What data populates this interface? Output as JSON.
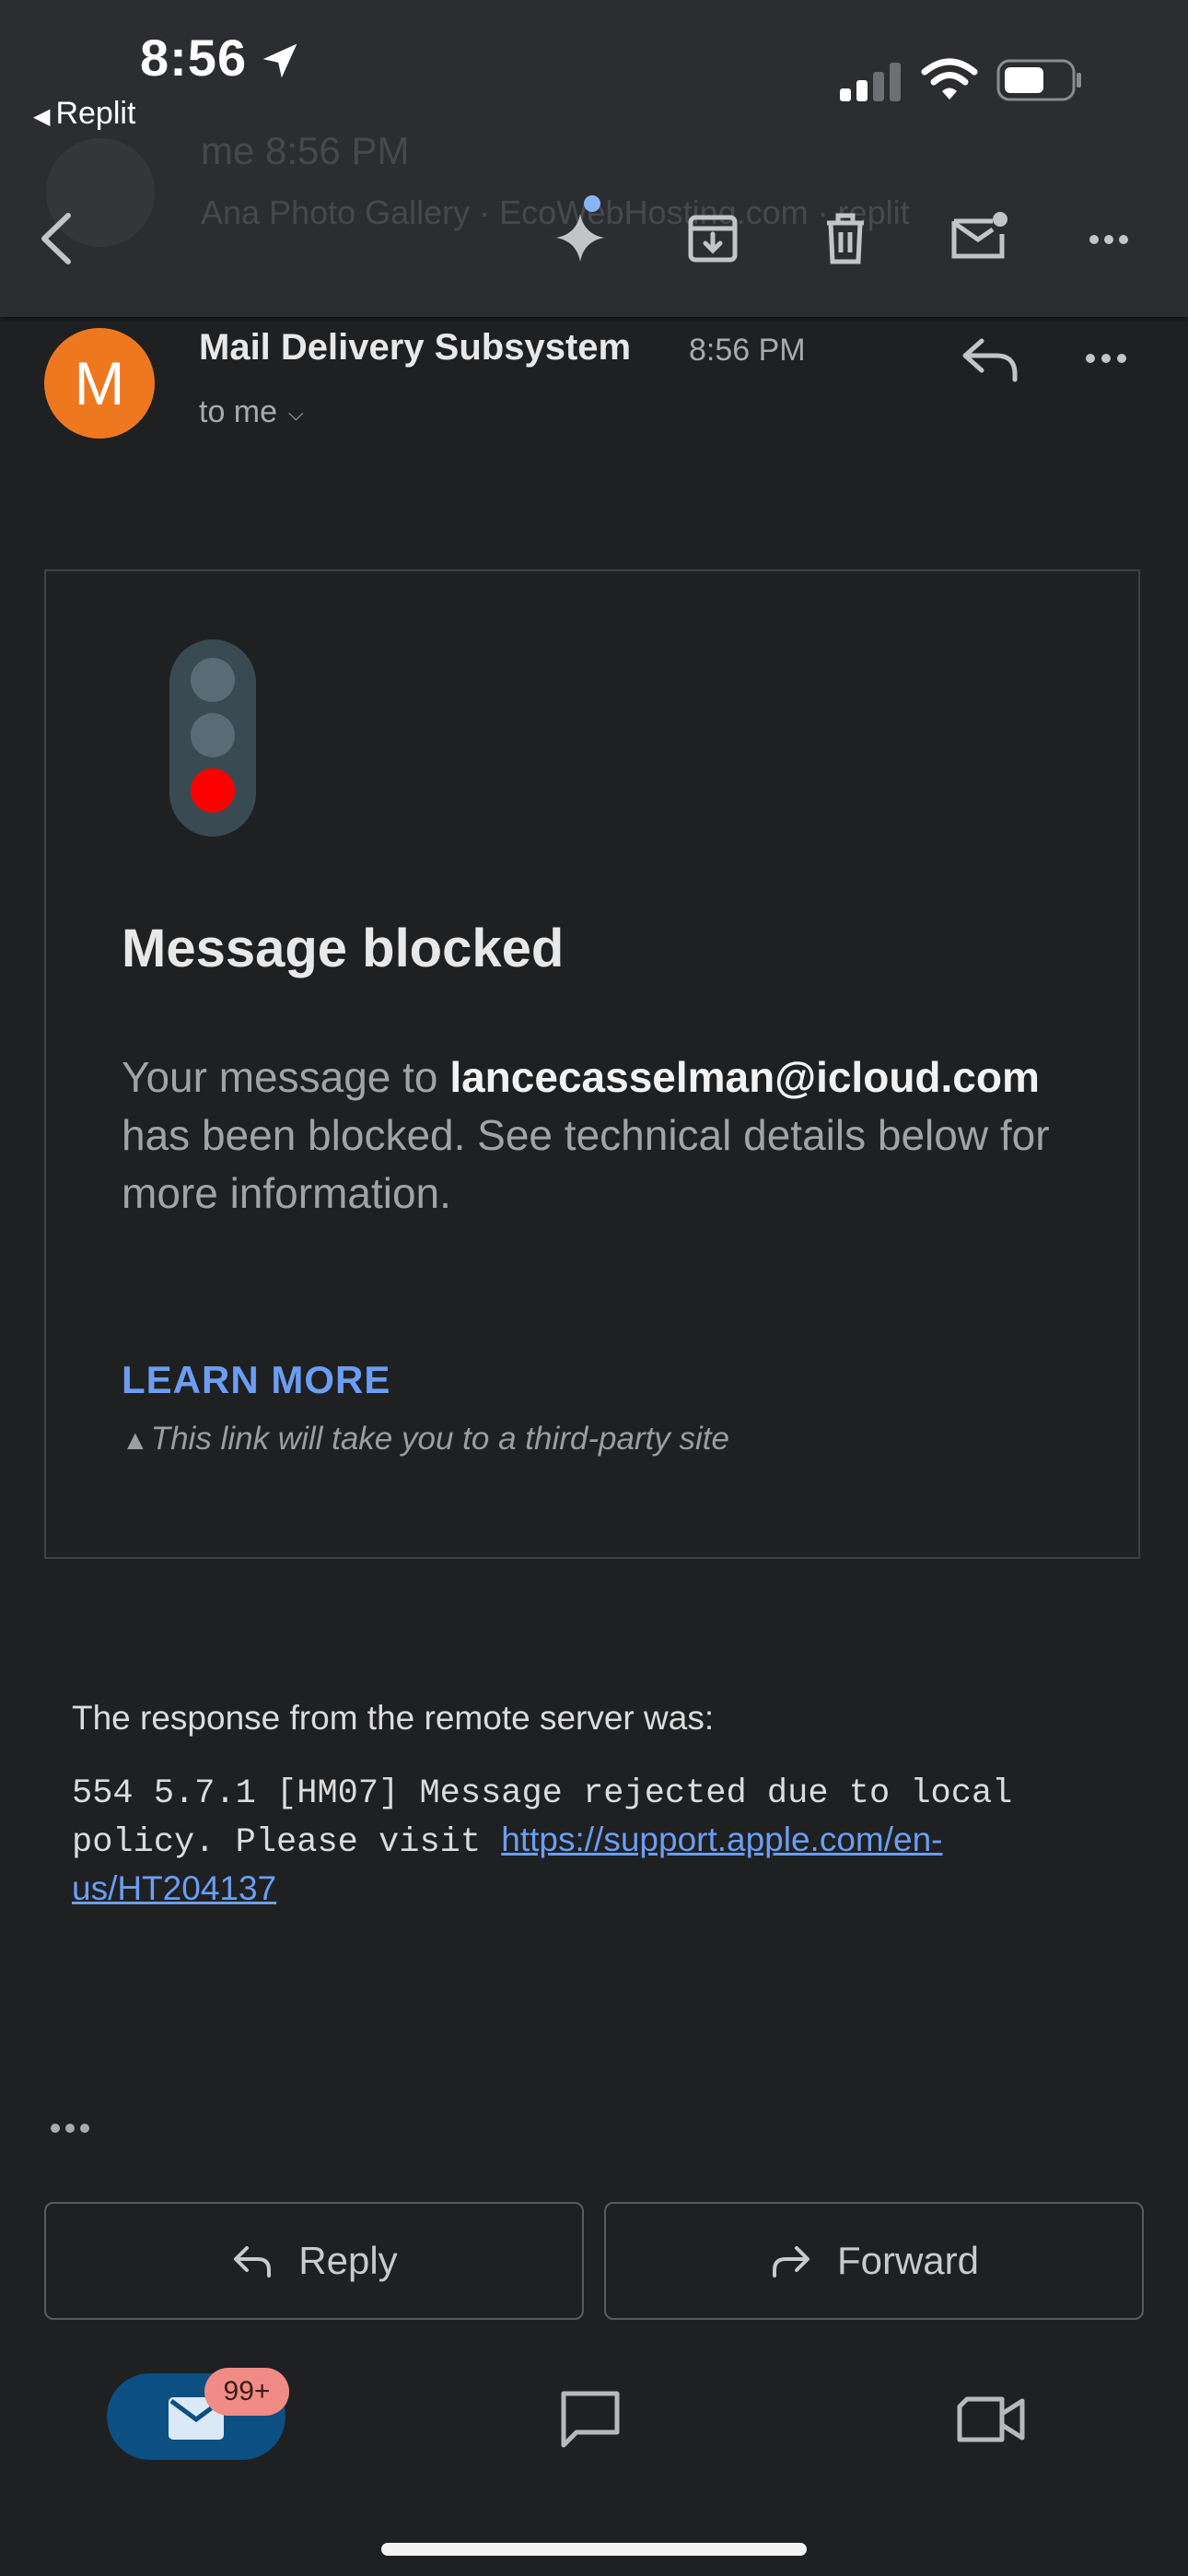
{
  "status_bar": {
    "time": "8:56",
    "back_app": "Replit"
  },
  "ghost_row": {
    "from": "me",
    "time": "8:56 PM",
    "preview": "Ana Photo Gallery · EcoWebHosting.com · replit"
  },
  "email": {
    "sender_initial": "M",
    "sender": "Mail Delivery Subsystem",
    "time": "8:56 PM",
    "to": "to me",
    "card": {
      "title": "Message blocked",
      "text_before": "Your message to ",
      "recipient": "lancecasselman@icloud.com",
      "text_after": " has been blocked. See technical details below for more information.",
      "learn_more": "LEARN MORE",
      "warning": "This link will take you to a third-party site"
    },
    "response_label": "The response from the remote server was:",
    "response_code": "554 5.7.1 [HM07] Message rejected due to local policy. Please visit ",
    "response_link": "https://support.apple.com/en-us/HT204137"
  },
  "actions": {
    "reply": "Reply",
    "forward": "Forward"
  },
  "nav": {
    "badge": "99+"
  },
  "colors": {
    "accent": "#6b9ef3",
    "avatar": "#ee7820",
    "traffic_red": "#ff0000"
  },
  "icons": [
    "back-icon",
    "gemini-sparkle-icon",
    "archive-icon",
    "trash-icon",
    "mark-unread-icon",
    "more-icon",
    "reply-icon",
    "forward-icon",
    "mail-icon",
    "chat-icon",
    "meet-icon"
  ]
}
